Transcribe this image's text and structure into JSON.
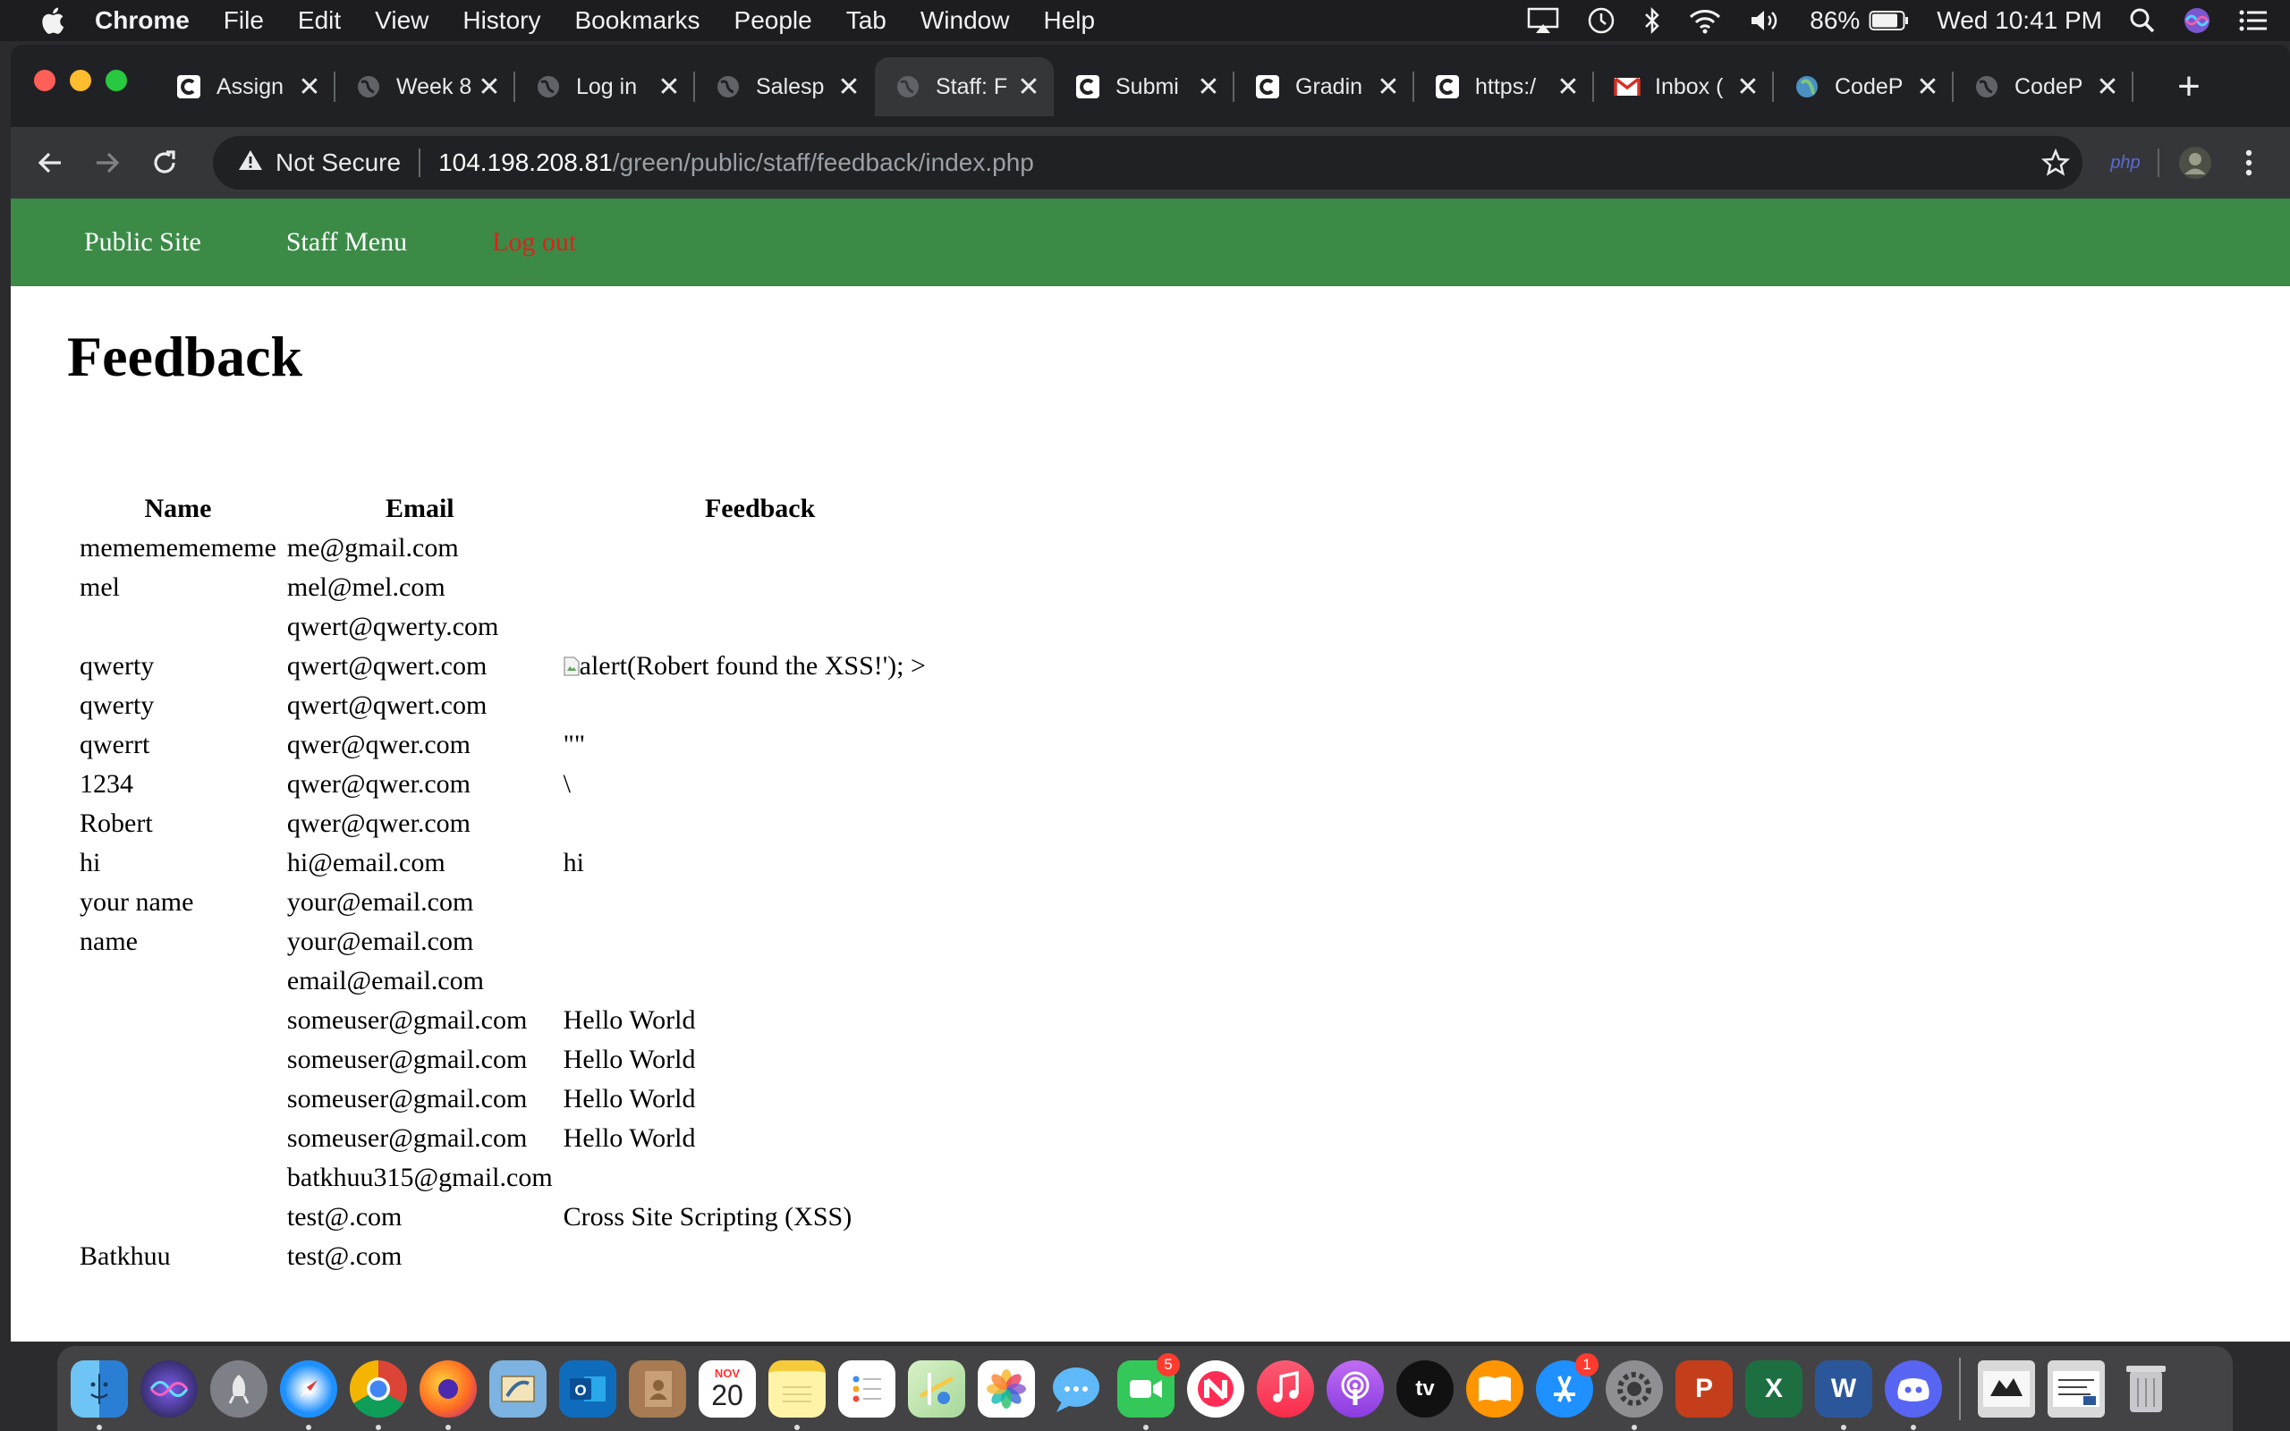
{
  "menubar": {
    "app": "Chrome",
    "items": [
      "File",
      "Edit",
      "View",
      "History",
      "Bookmarks",
      "People",
      "Tab",
      "Window",
      "Help"
    ],
    "battery": "86%",
    "clock": "Wed 10:41 PM"
  },
  "tabs": [
    {
      "title": "Assign",
      "icon": "canvas-icon",
      "active": false
    },
    {
      "title": "Week 8",
      "icon": "globe-icon",
      "active": false
    },
    {
      "title": "Log in",
      "icon": "globe-icon",
      "active": false
    },
    {
      "title": "Salesp",
      "icon": "globe-icon",
      "active": false
    },
    {
      "title": "Staff: F",
      "icon": "globe-icon",
      "active": true
    },
    {
      "title": "Submi",
      "icon": "canvas-icon",
      "active": false
    },
    {
      "title": "Gradin",
      "icon": "canvas-icon",
      "active": false
    },
    {
      "title": "https:/",
      "icon": "canvas-icon",
      "active": false
    },
    {
      "title": "Inbox (",
      "icon": "gmail-icon",
      "active": false
    },
    {
      "title": "CodeP",
      "icon": "codepen-icon",
      "active": false
    },
    {
      "title": "CodeP",
      "icon": "globe-icon",
      "active": false
    }
  ],
  "address": {
    "security": "Not Secure",
    "host": "104.198.208.81",
    "path": "/green/public/staff/feedback/index.php"
  },
  "site_nav": {
    "public_site": "Public Site",
    "staff_menu": "Staff Menu",
    "logout": "Log out"
  },
  "page": {
    "title": "Feedback"
  },
  "table": {
    "headers": [
      "Name",
      "Email",
      "Feedback"
    ],
    "rows": [
      [
        "memememememe",
        "me@gmail.com",
        ""
      ],
      [
        "mel",
        "mel@mel.com",
        ""
      ],
      [
        "",
        "qwert@qwerty.com",
        ""
      ],
      [
        "qwerty",
        "qwert@qwert.com",
        "alert(Robert found the XSS!'); >"
      ],
      [
        "qwerty",
        "qwert@qwert.com",
        ""
      ],
      [
        "qwerrt",
        "qwer@qwer.com",
        "\"\""
      ],
      [
        "1234",
        "qwer@qwer.com",
        "\\"
      ],
      [
        "Robert",
        "qwer@qwer.com",
        ""
      ],
      [
        "hi",
        "hi@email.com",
        "hi"
      ],
      [
        "your name",
        "your@email.com",
        ""
      ],
      [
        "name",
        "your@email.com",
        ""
      ],
      [
        "",
        "email@email.com",
        ""
      ],
      [
        "",
        "someuser@gmail.com",
        "Hello World"
      ],
      [
        "",
        "someuser@gmail.com",
        "Hello World"
      ],
      [
        "",
        "someuser@gmail.com",
        "Hello World"
      ],
      [
        "",
        "someuser@gmail.com",
        "Hello World"
      ],
      [
        "",
        "batkhuu315@gmail.com",
        ""
      ],
      [
        "",
        "test@.com",
        "Cross Site Scripting (XSS)"
      ],
      [
        "Batkhuu",
        "test@.com",
        ""
      ]
    ]
  },
  "dock": {
    "apps": [
      "Finder",
      "Siri",
      "Launchpad",
      "Safari",
      "Chrome",
      "Firefox",
      "Mail",
      "Outlook",
      "Contacts",
      "Calendar",
      "Notes",
      "Reminders",
      "Maps",
      "Photos",
      "Messages",
      "FaceTime",
      "News",
      "Music",
      "Podcasts",
      "TV",
      "Books",
      "App Store",
      "System Preferences",
      "PowerPoint",
      "Excel",
      "Word",
      "Discord"
    ],
    "calendar_month": "NOV",
    "calendar_day": "20",
    "facetime_badge": "5",
    "appstore_badge": "1",
    "tv_label": "tv"
  },
  "colors": {
    "site_nav_bg": "#3b8b47",
    "logout": "#e0201a"
  }
}
